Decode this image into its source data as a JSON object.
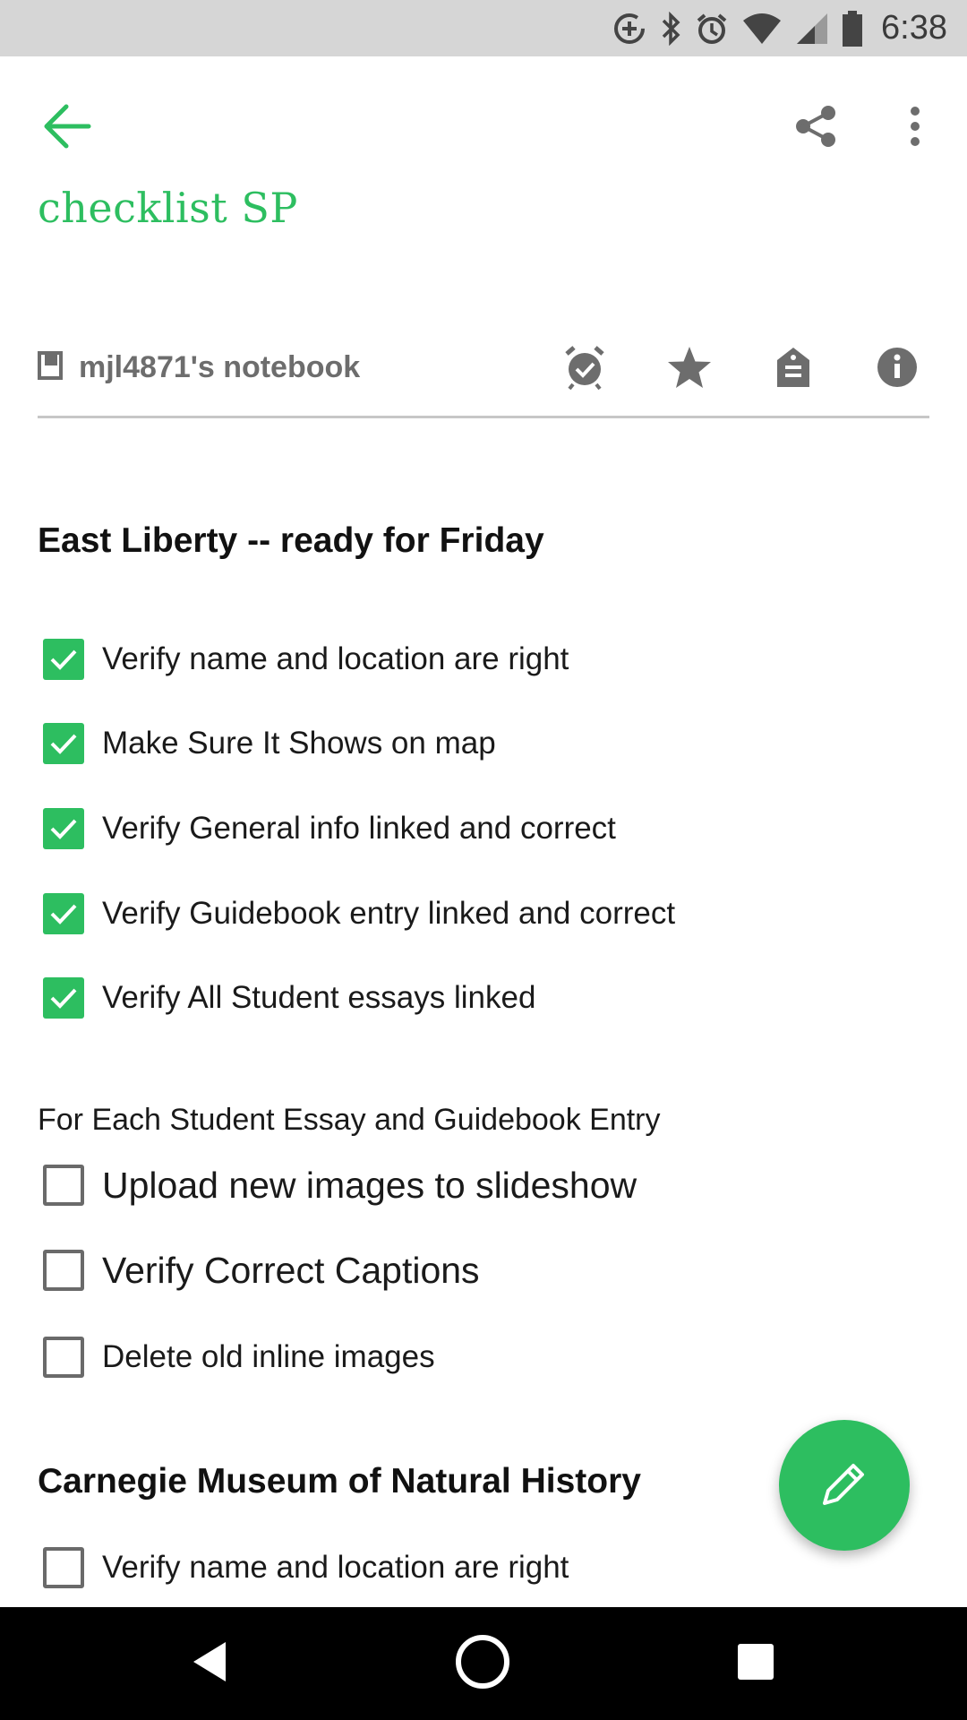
{
  "status_bar": {
    "time": "6:38",
    "icons": [
      "data-saver-icon",
      "bluetooth-icon",
      "alarm-icon",
      "wifi-icon",
      "signal-icon",
      "battery-icon"
    ]
  },
  "toolbar": {
    "back_icon": "arrow-back-icon",
    "share_icon": "share-icon",
    "menu_icon": "more-vert-icon"
  },
  "note": {
    "title": "checklist SP",
    "notebook": "mjl4871's notebook",
    "meta_icons": [
      "reminder-icon",
      "star-icon",
      "tag-icon",
      "info-icon"
    ]
  },
  "body": {
    "section1_heading": "East Liberty -- ready for Friday",
    "section1_items": [
      {
        "label": "Verify name and location are right",
        "checked": true
      },
      {
        "label": "Make Sure It Shows on map",
        "checked": true
      },
      {
        "label": "Verify General info linked and correct",
        "checked": true
      },
      {
        "label": "Verify Guidebook entry linked and correct",
        "checked": true
      },
      {
        "label": "Verify All Student essays linked",
        "checked": true
      }
    ],
    "subheading": "For Each Student Essay and Guidebook Entry",
    "section2_items": [
      {
        "label": "Upload new images to slideshow",
        "checked": false
      },
      {
        "label": "Verify Correct Captions",
        "checked": false
      },
      {
        "label": "Delete old inline images",
        "checked": false
      }
    ],
    "section2_heading": "Carnegie Museum of Natural History",
    "section3_items": [
      {
        "label": "Verify name and location are right",
        "checked": false
      }
    ]
  },
  "fab": {
    "icon": "pencil-icon"
  },
  "nav": {
    "icons": [
      "back-triangle-icon",
      "home-circle-icon",
      "recents-square-icon"
    ]
  },
  "colors": {
    "accent": "#2dbe60",
    "status_bar": "#d6d6d6",
    "nav_bar": "#000000"
  }
}
